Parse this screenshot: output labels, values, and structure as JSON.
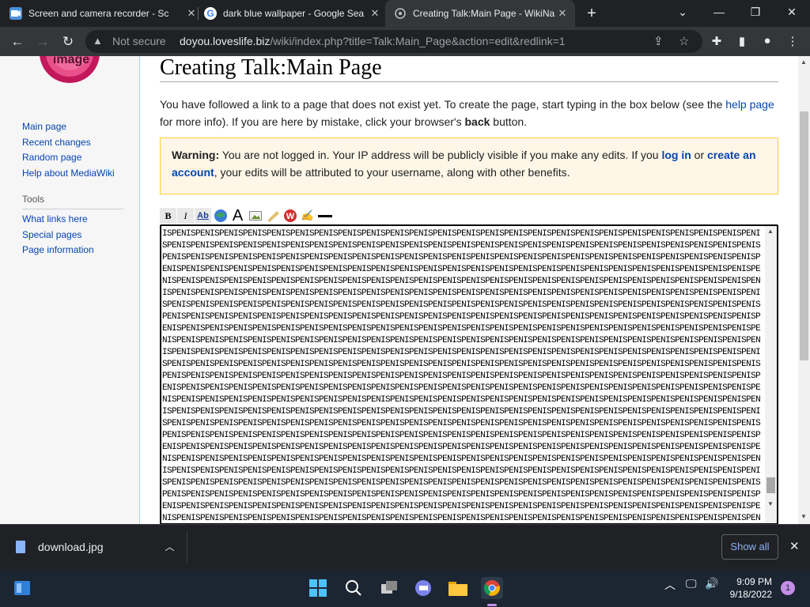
{
  "browser": {
    "tabs": [
      {
        "title": "Screen and camera recorder - Sc",
        "icon": "screen-recorder-icon",
        "active": false
      },
      {
        "title": "dark blue wallpaper - Google Sea",
        "icon": "google-icon",
        "active": false
      },
      {
        "title": "Creating Talk:Main Page - WikiNa",
        "icon": "globe-icon",
        "active": true
      }
    ],
    "not_secure_label": "Not secure",
    "url_host": "doyou.loveslife.biz",
    "url_path": "/wiki/index.php?title=Talk:Main_Page&action=edit&redlink=1"
  },
  "sidebar": {
    "logo_text": "own logo image",
    "nav": [
      "Main page",
      "Recent changes",
      "Random page",
      "Help about MediaWiki"
    ],
    "tools_heading": "Tools",
    "tools": [
      "What links here",
      "Special pages",
      "Page information"
    ]
  },
  "page": {
    "title": "Creating Talk:Main Page",
    "intro_a": "You have followed a link to a page that does not exist yet. To create the page, start typing in the box below (see the ",
    "intro_link": "help page",
    "intro_b": " for more info). If you are here by mistake, click your browser's ",
    "intro_bold": "back",
    "intro_c": " button.",
    "warning_label": "Warning:",
    "warning_a": " You are not logged in. Your IP address will be publicly visible if you make any edits. If you ",
    "login_link": "log in",
    "warning_b": " or ",
    "create_link": "create an account",
    "warning_c": ", your edits will be attributed to your username, along with other benefits.",
    "editor_text": "ISPENISPENISPENISPENISPENISPENISPENISPENISPENISPENISPENISPENISPENISPENISPENISPENISPENISPENISPENISPENISPENISPENISPENISPENISPENISPENISPENISPENISPENISPENISPENISPENISPENISPENISPENISPENISPENISPENISPENISPENISPENISPENISPENISPENISPENISPENISPENISPENISPENISPENISPENISPENISPENISPENISPENISPENISPENISPENISPENISPENISPENISPENISPENISPENISPENISPENISPENISPENISPENISPENISPENISPENISPENISPENISPENISPENISPENISPENISPENISPENISPENISPENISPENISPENISPENISPENISPENISPENISPENISPENISPENISPENISPENISPENISPENISPENISPENISPENISPENISPENISPENISPENISPENISPENISPENISPENISPENISPENISPENISPENISPENISPENISPENISPENISPENISPENISPENISPENISPENISPENISPENISPENISPENISPENISPENISPENISPENISPENISPENISPENISPENISPENISPENISPENISPENISPENISPENISPENISPENISPENISPENISPENISPENISPENISPENISPENISPENISPENISPENISPENISPENISPENISPENISPENISPENISPENISPENISPENISPENISPENISPENISPENISPENISPENISPENISPENISPENISPENISPENISPENISPENISPENISPENISPENISPENISPENISPENISPENISPENISPENISPENISPENISPENISPENISPENISPENISPENISPENISPENISPENISPENISPENISPENISPENISPENISPENISPENISPENISPENISPENISPENISPENISPENISPENISPENISPENISPENISPENISPENISPENISPENISPENISPENISPENISPENISPENISPENISPENISPENISPENISPENISPENISPENISPENISPENISPENISPENISPENISPENISPENISPENISPENISPENISPENISPENISPENISPENISPENISPENISPENISPENISPENISPENISPENISPENISPENISPENISPENISPENISPENISPENISPENISPENISPENISPENISPENISPENISPENISPENISPENISPENISPENISPENISPENISPENISPENISPENISPENISPENISPENISPENISPENISPENISPENISPENISPENISPENISPENISPENISPENISPENISPENISPENISPENISPENISPENISPENISPENISPENISPENISPENISPENISPENISPENISPENISPENISPENISPENISPENISPENISPENISPENISPENISPENISPENISPENISPENISPENISPENISPENISPENISPENISPENISPENISPENISPENISPENISPENISPENISPENISPENISPENISPENISPENISPENISPENISPENISPENISPENISPENISPENISPENISPENISPENISPENISPENISPENISPENISPENISPENISPENISPENISPENISPENISPENISPENISPENISPENISPENISPENISPENISPENISPENISPENISPENISPENISPENISPENISPENISPENISPENISPENISPENISPENISPENISPENISPENISPENISPENISPENISPENISPENISPENISPENISPENISPENISPENISPENISPENISPENISPENISPENISPENISPENISPENISPENISPENISPENISPENISPENISPENISPENISPENISPENISPENISPENISPENISPENISPENISPENISPENISPENISPENISPENISPENISPENISPENISPENISPENISPENISPENISPENISPENISPENISPENISPENISPENISPENISPENISPENISPENISPENISPENISPENISPENISPENISPENISPENISPENISPENISPENISPENISPENISPENISPENISPENISPENISPENISPENISPENISPENISPENISPENISPENISPENISPENISPENISPENISPENISPENISPENISPENISPENISPENISPENISPENISPENISPENISPENISPENISPENISPENISPENISPENISPENISPENISPENISPENISPENISPENISPENISPENISPENISPENISPENISPENISPENISPENISPENISPENISPENISPENISPENISPENISPENISPENISPENISPENISPENISPENISPENISPENISPENISPENISPENISPENISPENISPENISPENISPENISPENISPENISPENISPENISPENISPENISPENISPENISPENISPENISPENISPENISPENISPENISPENISPENISPENISPENISPENISPENISPENISPENISPENISPENISPENISPENISPENISPENISPENISPENISPENISPENISPENISPENISPENISPENISPENISPENISPENISPENISPENISPENISPENISPENISPENISPENISPENISPENISPENISPENISPENISPENISPENISPENISPENISPENISPENISPENISPENISPENISPENISPENISPENISPENISPENISPENISPENISPENISPENISPENISPENISPENISPENISPENISPENISPENISPENISPENISPENISPENISPENISPENISPENISPENISPENISPENISPENISPENISPENISPENISPENISPENISPENISPENISPENISPENISPENISPENISPENISPENISPENISPENISPENISPENISPENISPENISPENISPENISPENISPENISPENISPENISPENISPENISPENISPENISPENISPENISPENISPENISPENISPENISPENISPENISPENISPENISPENISPENISPENISPENISPENISPENISPENISPENISPENISPENISPENISPENISPENISPENISPENISPENISPENISPENISPENISPENISPENISPENISPENISPENISPENISPENISPENISPENISPENISPENISPENISPENISPENISPENISPENISPENISPENISPENISPENISPENISPENISPENISPENISPENISPENISPENISPENISPENISPENISPENISPENISPENISPENISPENISPENISPENISPENISPENISPENISPENISPENISPENISPENISPENISPENISPENISPENISPENISPENISPENISPENISPENISPENISPENISPENISPENISPENISPENISPENISPENISPENISPENISPENISPENISPENISPENISPENISPENISPENISPENISPENISPENISPENISPENISPENISPENISPENISPENISPENISPENISPENISPENISPENISPENISPENISPENISPENISPENISPENISPENISPENISPENISPENISPENISPENISPENISPENISPENISPENISPENISPENISPENISPENISPENISPENISPENISPENISPENISPENISPENISPENISPENISPENISPENISPENISPENISPENISPENISPENISPENISPENISPENISPENISPENISPENISPENISPENISPENISPENISPENISPENISPENISPENISPENISPENISPENISPENISPENISPENISPENISPENISPENISPENISPENISPENISPENISPENISPENISPENISPENISPENISPENISPENIS"
  },
  "downloads": {
    "file": "download.jpg",
    "show_all": "Show all"
  },
  "taskbar": {
    "time": "9:09 PM",
    "date": "9/18/2022",
    "notification_count": "1"
  }
}
